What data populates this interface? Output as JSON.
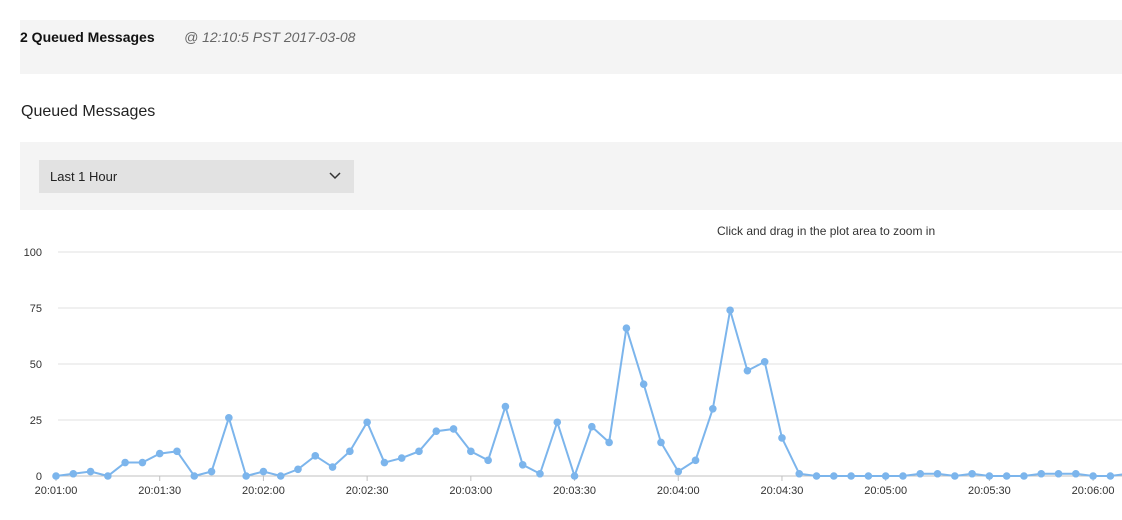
{
  "header": {
    "title": "2 Queued Messages",
    "timestamp": "@ 12:10:5 PST 2017-03-08"
  },
  "section": {
    "title": "Queued Messages"
  },
  "filter": {
    "range_value": "Last 1 Hour"
  },
  "chart_hint": "Click and drag in the plot area to zoom in",
  "chart_data": {
    "type": "line",
    "title": "",
    "xlabel": "",
    "ylabel": "",
    "ylim": [
      0,
      100
    ],
    "yticks": [
      0,
      25,
      50,
      75,
      100
    ],
    "grid": true,
    "color": "#7cb5ec",
    "x_start": "20:01:00",
    "x_end": "20:06:10",
    "xticks": [
      "20:01:00",
      "20:01:30",
      "20:02:00",
      "20:02:30",
      "20:03:00",
      "20:03:30",
      "20:04:00",
      "20:04:30",
      "20:05:00",
      "20:05:30",
      "20:06:00"
    ],
    "series": [
      {
        "x": [
          "20:01:00",
          "20:01:05",
          "20:01:10",
          "20:01:15",
          "20:01:20",
          "20:01:25",
          "20:01:30",
          "20:01:35",
          "20:01:40",
          "20:01:45",
          "20:01:50",
          "20:01:55",
          "20:02:00",
          "20:02:05",
          "20:02:10",
          "20:02:15",
          "20:02:20",
          "20:02:25",
          "20:02:30",
          "20:02:35",
          "20:02:40",
          "20:02:45",
          "20:02:50",
          "20:02:55",
          "20:03:00",
          "20:03:05",
          "20:03:10",
          "20:03:15",
          "20:03:20",
          "20:03:25",
          "20:03:30",
          "20:03:35",
          "20:03:40",
          "20:03:45",
          "20:03:50",
          "20:03:55",
          "20:04:00",
          "20:04:05",
          "20:04:10",
          "20:04:15",
          "20:04:20",
          "20:04:25",
          "20:04:30",
          "20:04:35",
          "20:04:40",
          "20:04:45",
          "20:04:50",
          "20:04:55",
          "20:05:00",
          "20:05:05",
          "20:05:10",
          "20:05:15",
          "20:05:20",
          "20:05:25",
          "20:05:30",
          "20:05:35",
          "20:05:40",
          "20:05:45",
          "20:05:50",
          "20:05:55",
          "20:06:00",
          "20:06:05",
          "20:06:10"
        ],
        "values": [
          0,
          1,
          2,
          0,
          6,
          6,
          10,
          11,
          0,
          2,
          26,
          0,
          2,
          0,
          3,
          9,
          4,
          11,
          24,
          6,
          8,
          11,
          20,
          21,
          11,
          7,
          31,
          5,
          1,
          24,
          0,
          22,
          15,
          66,
          41,
          15,
          2,
          7,
          30,
          74,
          47,
          51,
          17,
          1,
          0,
          0,
          0,
          0,
          0,
          0,
          1,
          1,
          0,
          1,
          0,
          0,
          0,
          1,
          1,
          1,
          0,
          0,
          1
        ]
      }
    ]
  }
}
